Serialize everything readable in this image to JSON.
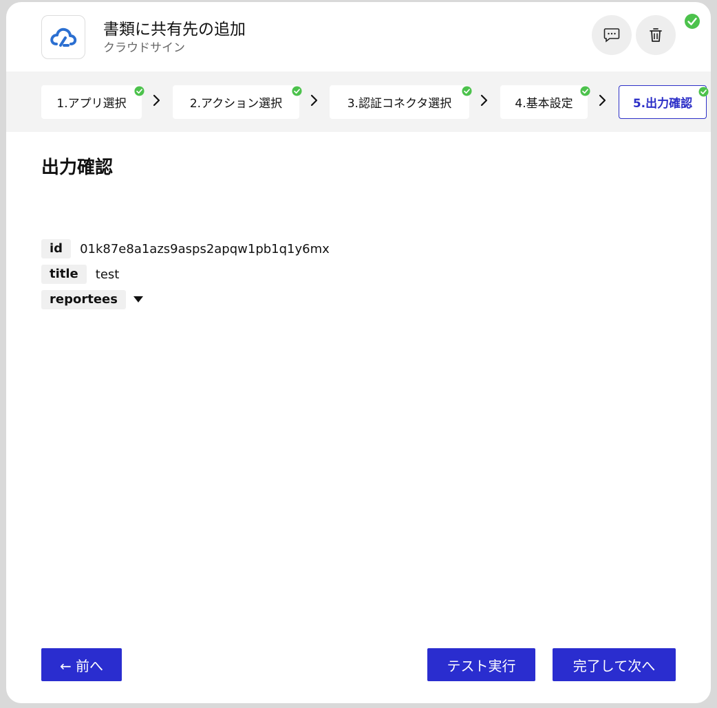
{
  "header": {
    "title": "書類に共有先の追加",
    "subtitle": "クラウドサイン",
    "app_icon": "cloudsign-logo-icon",
    "comment_icon": "comment-icon",
    "delete_icon": "trash-icon",
    "status_icon": "check-circle-icon"
  },
  "stepper": {
    "steps": [
      {
        "label": "1.アプリ選択",
        "done": true
      },
      {
        "label": "2.アクション選択",
        "done": true
      },
      {
        "label": "3.認証コネクタ選択",
        "done": true
      },
      {
        "label": "4.基本設定",
        "done": true
      },
      {
        "label": "5.出力確認",
        "done": true,
        "active": true
      }
    ]
  },
  "section": {
    "title": "出力確認"
  },
  "fields": [
    {
      "key": "id",
      "value": "01k87e8a1azs9asps2apqw1pb1q1y6mx"
    },
    {
      "key": "title",
      "value": "test"
    },
    {
      "key": "reportees",
      "value": ""
    }
  ],
  "footer": {
    "prev_label": "← 前へ",
    "test_label": "テスト実行",
    "next_label": "完了して次へ"
  },
  "colors": {
    "accent": "#2a2dcf",
    "success": "#4cc24c",
    "stepper_bg": "#f3f3f3"
  }
}
